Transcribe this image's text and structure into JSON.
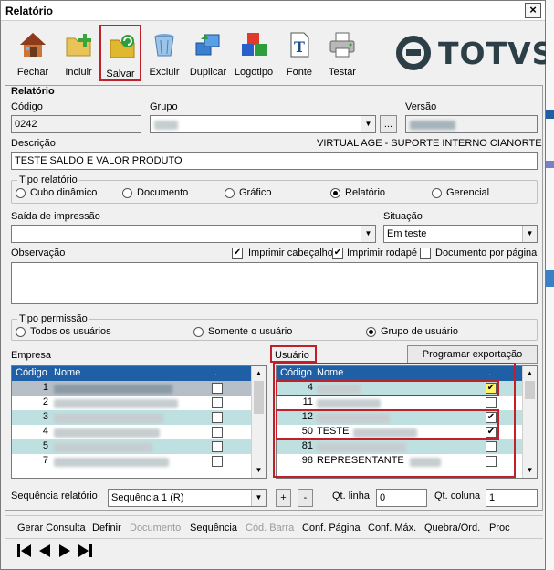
{
  "window": {
    "title": "Relatório",
    "close": "×"
  },
  "toolbar": [
    {
      "label": "Fechar",
      "icon": "house-icon"
    },
    {
      "label": "Incluir",
      "icon": "add-folder-icon"
    },
    {
      "label": "Salvar",
      "icon": "save-folder-icon"
    },
    {
      "label": "Excluir",
      "icon": "trash-icon"
    },
    {
      "label": "Duplicar",
      "icon": "duplicate-icon"
    },
    {
      "label": "Logotipo",
      "icon": "shapes-icon"
    },
    {
      "label": "Fonte",
      "icon": "font-icon"
    },
    {
      "label": "Testar",
      "icon": "printer-icon"
    }
  ],
  "logo": {
    "text": "TOTVS",
    "color": "#2c3e46"
  },
  "panel_title": "Relatório",
  "labels": {
    "codigo": "Código",
    "grupo": "Grupo",
    "versao": "Versão",
    "descricao": "Descrição",
    "saida": "Saída de impressão",
    "situacao": "Situação",
    "observacao": "Observação",
    "empresa": "Empresa",
    "usuario": "Usuário",
    "sequencia": "Sequência relatório",
    "qt_linha": "Qt. linha",
    "qt_coluna": "Qt. coluna"
  },
  "values": {
    "codigo": "0242",
    "descricao": "TESTE SALDO E VALOR PRODUTO",
    "empresa_info": "VIRTUAL AGE - SUPORTE INTERNO CIANORTE",
    "situacao": "Em teste",
    "sequencia": "Sequência 1 (R)",
    "qt_linha": "0",
    "qt_coluna": "1"
  },
  "grupo_browse": "...",
  "tipo_relatorio": {
    "title": "Tipo relatório",
    "options": [
      "Cubo dinâmico",
      "Documento",
      "Gráfico",
      "Relatório",
      "Gerencial"
    ],
    "selected": "Relatório"
  },
  "print_options": {
    "cabecalho": {
      "label": "Imprimir cabeçalho",
      "checked": true
    },
    "rodape": {
      "label": "Imprimir rodapé",
      "checked": true
    },
    "pagina": {
      "label": "Documento por página",
      "checked": false
    }
  },
  "tipo_permissao": {
    "title": "Tipo permissão",
    "options": [
      "Todos os usuários",
      "Somente o usuário",
      "Grupo de usuário"
    ],
    "selected": "Grupo de usuário"
  },
  "programar_exportacao": "Programar exportação",
  "empresa_grid": {
    "columns": [
      "Código",
      "Nome",
      "."
    ],
    "rows": [
      {
        "code": "1"
      },
      {
        "code": "2"
      },
      {
        "code": "3"
      },
      {
        "code": "4"
      },
      {
        "code": "5"
      },
      {
        "code": "7"
      }
    ]
  },
  "usuario_grid": {
    "columns": [
      "Código",
      "Nome",
      "."
    ],
    "rows": [
      {
        "code": "4",
        "name": "",
        "checked": true
      },
      {
        "code": "11",
        "name": "",
        "checked": false
      },
      {
        "code": "12",
        "name": "",
        "checked": true
      },
      {
        "code": "50",
        "name": "TESTE",
        "checked": true
      },
      {
        "code": "81",
        "name": "",
        "checked": false
      },
      {
        "code": "98",
        "name": "REPRESENTANTE",
        "checked": false
      }
    ]
  },
  "seq_buttons": [
    "+",
    "-"
  ],
  "menu": [
    {
      "label": "Gerar Consulta",
      "enabled": true
    },
    {
      "label": "Definir",
      "enabled": true
    },
    {
      "label": "Documento",
      "enabled": false
    },
    {
      "label": "Sequência",
      "enabled": true
    },
    {
      "label": "Cód. Barra",
      "enabled": false
    },
    {
      "label": "Conf. Página",
      "enabled": true
    },
    {
      "label": "Conf. Máx.",
      "enabled": true
    },
    {
      "label": "Quebra/Ord.",
      "enabled": true
    },
    {
      "label": "Proc",
      "enabled": true
    }
  ],
  "nav": [
    "first-record-icon",
    "prev-record-icon",
    "next-record-icon",
    "last-record-icon"
  ],
  "colors": {
    "grid_header": "#1f5fa6",
    "highlight": "#c0202a",
    "row_alt": "#bfe0e0"
  }
}
